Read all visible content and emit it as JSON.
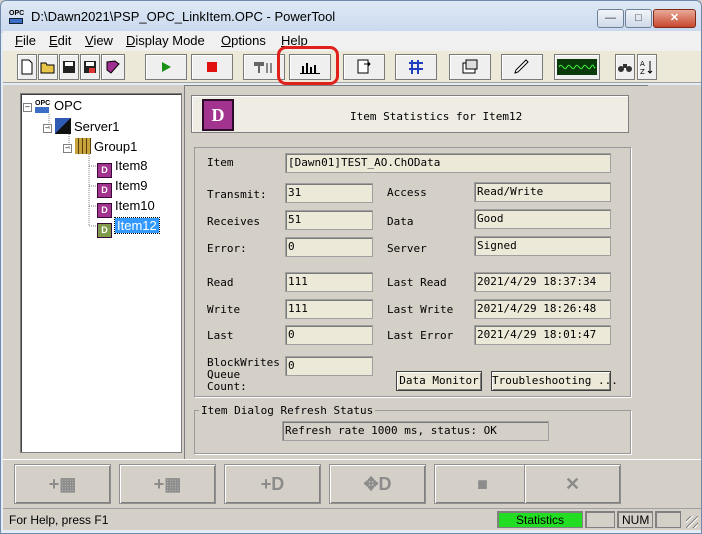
{
  "window": {
    "title": "D:\\Dawn2021\\PSP_OPC_LinkItem.OPC - PowerTool",
    "app_icon_text": "OPC"
  },
  "menu": [
    {
      "label": "File",
      "accel": "F",
      "rest": "ile"
    },
    {
      "label": "Edit",
      "accel": "E",
      "rest": "dit"
    },
    {
      "label": "View",
      "accel": "V",
      "rest": "iew"
    },
    {
      "label": "Display Mode",
      "accel": "D",
      "rest": "isplay Mode"
    },
    {
      "label": "Options",
      "accel": "O",
      "rest": "ptions"
    },
    {
      "label": "Help",
      "accel": "H",
      "rest": "elp"
    }
  ],
  "tree": {
    "root": "OPC",
    "server": "Server1",
    "group": "Group1",
    "items": [
      "Item8",
      "Item9",
      "Item10",
      "Item12"
    ],
    "selected": "Item12"
  },
  "header": {
    "title": "Item Statistics for Item12",
    "cube_letter": "D"
  },
  "stats": {
    "item_label": "Item",
    "item_value": "[Dawn01]TEST_AO.ChOData",
    "transmit_label": "Transmit:",
    "transmit_value": "31",
    "receives_label": "Receives",
    "receives_value": "51",
    "error_label": "Error:",
    "error_value": "0",
    "access_label": "Access",
    "access_value": "Read/Write",
    "data_label": "Data",
    "data_value": "Good",
    "server_label": "Server",
    "server_value": "Signed",
    "read_label": "Read",
    "read_value": "111",
    "write_label": "Write",
    "write_value": "111",
    "last_label": "Last",
    "last_value": "0",
    "last_read_label": "Last Read",
    "last_read_value": "2021/4/29 18:37:34",
    "last_write_label": "Last Write",
    "last_write_value": "2021/4/29 18:26:48",
    "last_error_label": "Last Error",
    "last_error_value": "2021/4/29 18:01:47",
    "queue_label_1": "BlockWrites",
    "queue_label_2": "Queue",
    "queue_label_3": "Count:",
    "queue_value": "0"
  },
  "buttons": {
    "data_monitor": "Data Monitor",
    "troubleshooting": "Troubleshooting ..."
  },
  "refresh": {
    "title": "Item Dialog Refresh Status",
    "status": "Refresh rate 1000 ms, status: OK"
  },
  "statusbar": {
    "help": "For Help, press F1",
    "stats": "Statistics",
    "num": "NUM"
  },
  "colors": {
    "highlight": "#e0201a",
    "selection": "#3399ff",
    "stats_pane": "#22dd22"
  }
}
